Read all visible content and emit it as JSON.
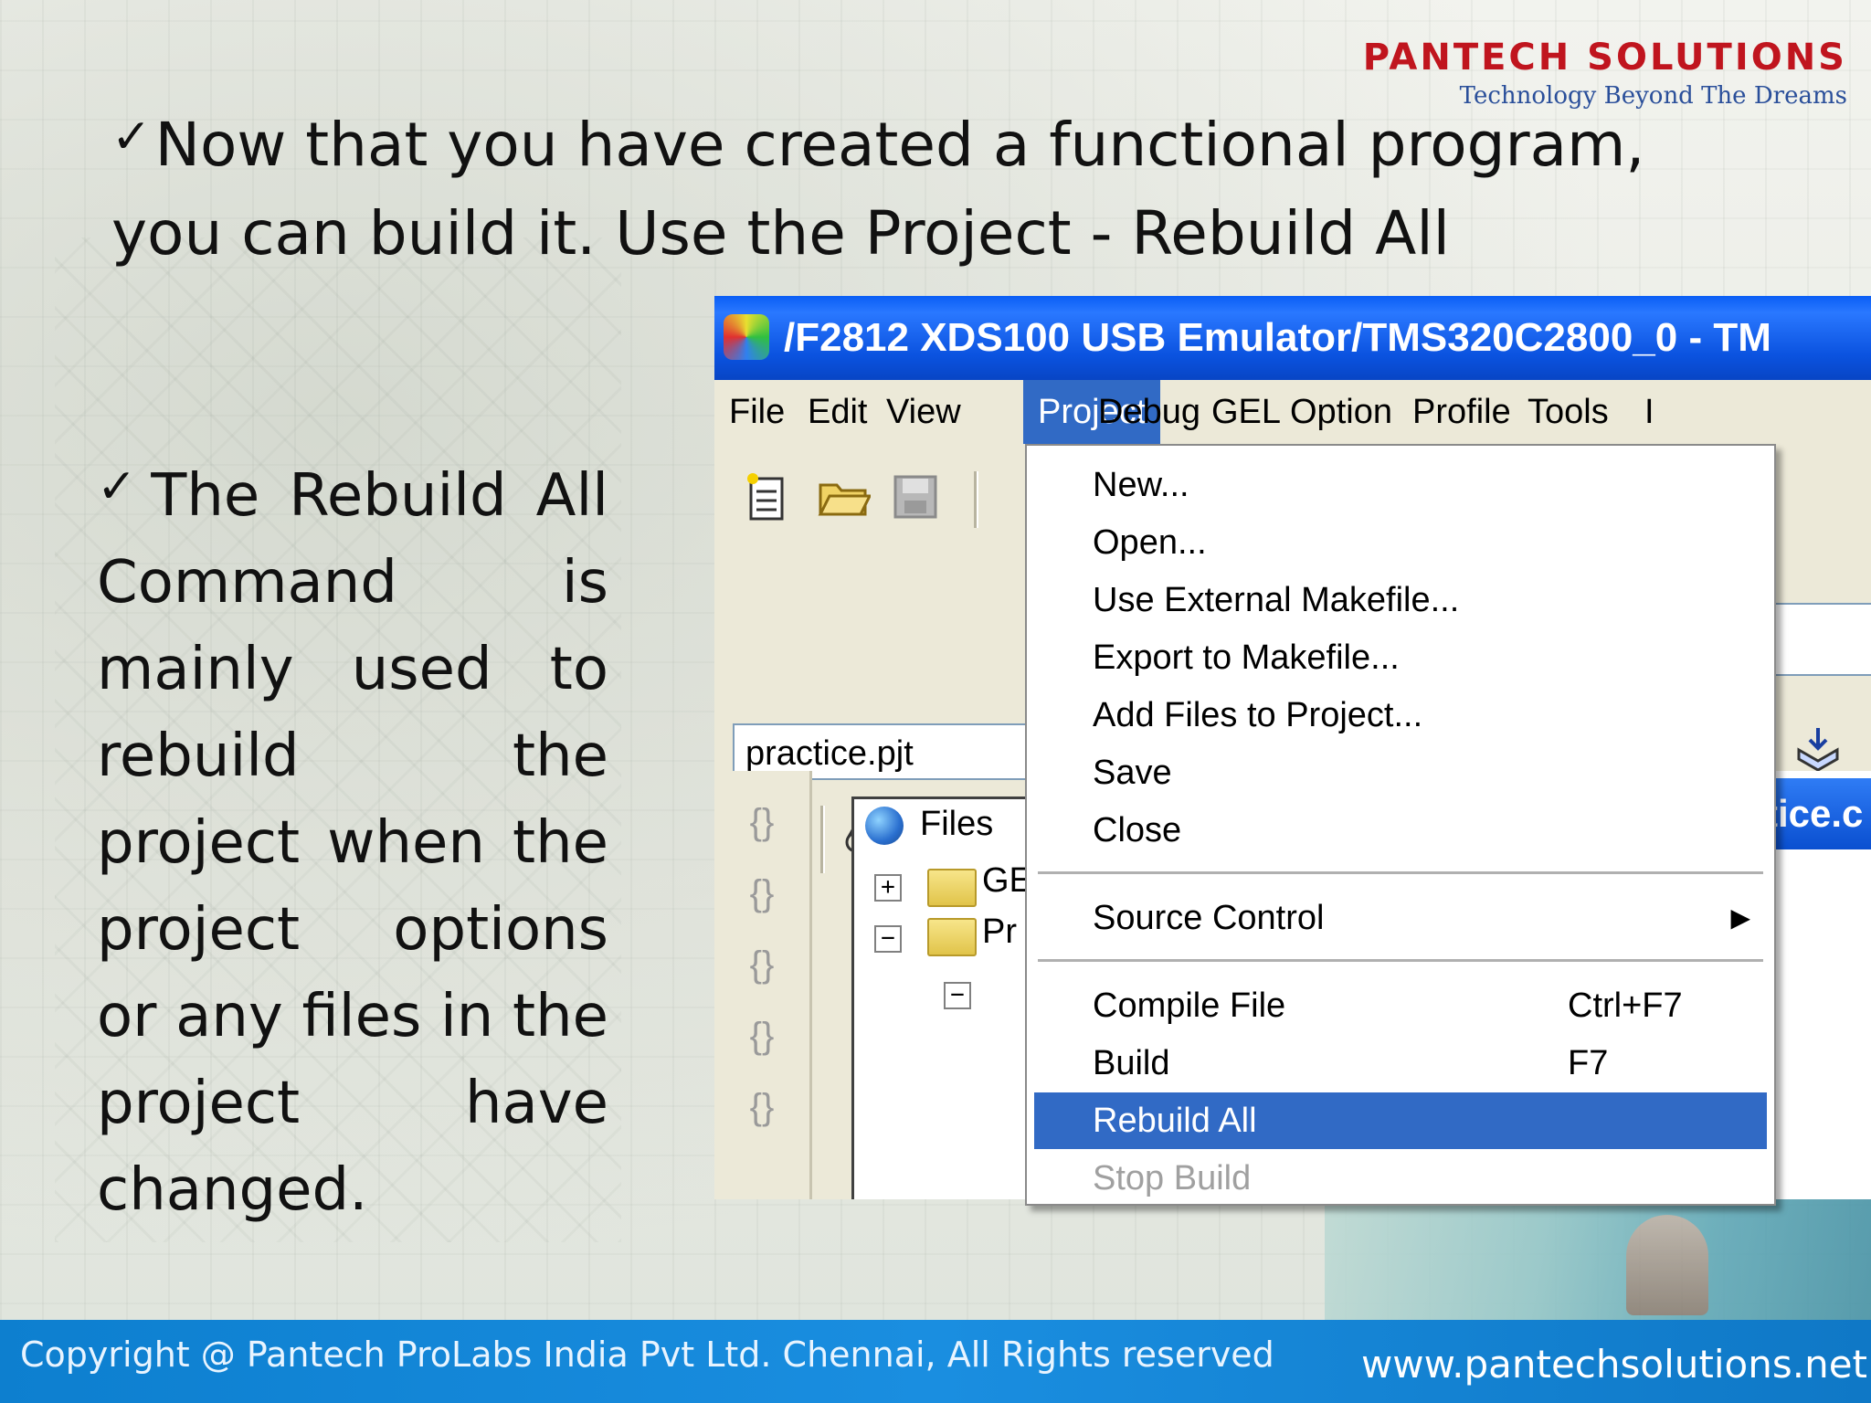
{
  "logo": {
    "name": "PANTECH SOLUTIONS",
    "tagline": "Technology Beyond The Dreams"
  },
  "slide": {
    "check_mark": "✓",
    "main_text": "Now that you have created a functional program, you can build it. Use the Project - Rebuild All",
    "side_text": "The Rebuild All Command is mainly used to rebuild the project when the project options or any files in the project have changed."
  },
  "window": {
    "title": "/F2812 XDS100 USB Emulator/TMS320C2800_0 - TM",
    "menu": [
      "File",
      "Edit",
      "View",
      "Project",
      "Debug",
      "GEL",
      "Option",
      "Profile",
      "Tools",
      "I"
    ],
    "active_menu": "Project",
    "project_select": "practice.pjt",
    "tree": {
      "root": "Files",
      "item1": "GE",
      "item2": "Pr"
    },
    "right_title": "tice.c",
    "dropdown": {
      "items": [
        {
          "label": "New...",
          "shortcut": ""
        },
        {
          "label": "Open...",
          "shortcut": ""
        },
        {
          "label": "Use External Makefile...",
          "shortcut": ""
        },
        {
          "label": "Export to Makefile...",
          "shortcut": ""
        },
        {
          "label": "Add Files to Project...",
          "shortcut": ""
        },
        {
          "label": "Save",
          "shortcut": ""
        },
        {
          "label": "Close",
          "shortcut": ""
        },
        {
          "label": "Source Control",
          "shortcut": ""
        },
        {
          "label": "Compile File",
          "shortcut": "Ctrl+F7"
        },
        {
          "label": "Build",
          "shortcut": "F7"
        },
        {
          "label": "Rebuild All",
          "shortcut": ""
        },
        {
          "label": "Stop Build",
          "shortcut": ""
        }
      ],
      "highlighted": "Rebuild All",
      "disabled": "Stop Build"
    }
  },
  "footer": {
    "copyright": "Copyright @ Pantech ProLabs India Pvt Ltd. Chennai, All Rights reserved",
    "url": "www.pantechsolutions.net"
  },
  "icons": {
    "new-file": "new-file-icon",
    "open-folder": "open-folder-icon",
    "save": "save-icon",
    "submenu-arrow": "submenu-arrow-icon"
  },
  "colors": {
    "titlebar": "#0b53e0",
    "menu_highlight": "#316ac5",
    "logo_red": "#c0151e",
    "logo_blue": "#2a4f9a",
    "footer": "#1a8ee0"
  }
}
